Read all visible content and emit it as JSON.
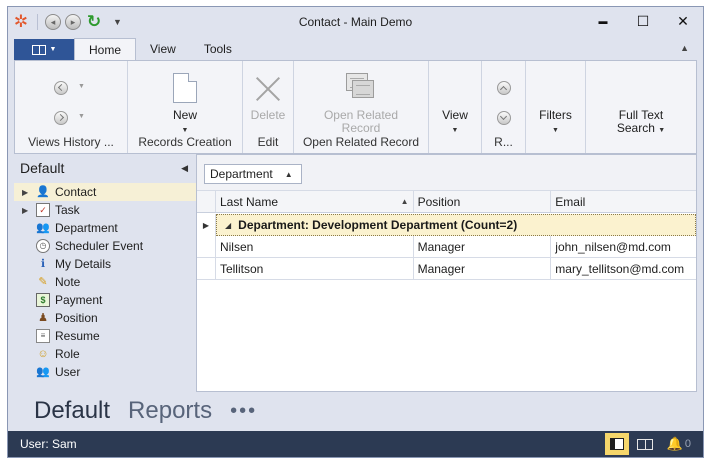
{
  "window": {
    "title": "Contact - Main Demo"
  },
  "quick_access": {
    "icons": [
      "app-gear-icon",
      "back-icon",
      "forward-icon",
      "refresh-icon",
      "customize-icon"
    ]
  },
  "window_controls": {
    "minimize": "▬",
    "maximize": "☐",
    "close": "✕"
  },
  "ribbon_tabs": [
    {
      "label": "Home",
      "active": true
    },
    {
      "label": "View",
      "active": false
    },
    {
      "label": "Tools",
      "active": false
    }
  ],
  "ribbon": {
    "groups": [
      {
        "caption": "Views History ..."
      },
      {
        "caption": "Records Creation",
        "button": "New"
      },
      {
        "caption": "Edit",
        "button": "Delete"
      },
      {
        "caption": "Open Related Record",
        "button_line1": "Open Related",
        "button_line2": "Record"
      },
      {
        "caption": "",
        "button": "View"
      },
      {
        "caption": "R..."
      },
      {
        "caption": "",
        "button": "Filters"
      },
      {
        "caption": "",
        "button_line1": "Full Text",
        "button_line2": "Search"
      }
    ]
  },
  "sidebar": {
    "title": "Default",
    "items": [
      {
        "label": "Contact",
        "icon": "contact-icon",
        "expandable": true,
        "selected": true
      },
      {
        "label": "Task",
        "icon": "task-icon",
        "expandable": true,
        "selected": false
      },
      {
        "label": "Department",
        "icon": "department-icon",
        "expandable": false,
        "selected": false
      },
      {
        "label": "Scheduler Event",
        "icon": "scheduler-icon",
        "expandable": false,
        "selected": false
      },
      {
        "label": "My Details",
        "icon": "my-details-icon",
        "expandable": false,
        "selected": false
      },
      {
        "label": "Note",
        "icon": "note-icon",
        "expandable": false,
        "selected": false
      },
      {
        "label": "Payment",
        "icon": "payment-icon",
        "expandable": false,
        "selected": false
      },
      {
        "label": "Position",
        "icon": "position-icon",
        "expandable": false,
        "selected": false
      },
      {
        "label": "Resume",
        "icon": "resume-icon",
        "expandable": false,
        "selected": false
      },
      {
        "label": "Role",
        "icon": "role-icon",
        "expandable": false,
        "selected": false
      },
      {
        "label": "User",
        "icon": "user-icon",
        "expandable": false,
        "selected": false
      }
    ]
  },
  "grid": {
    "group_by_chip": "Department",
    "columns": [
      "Last Name",
      "Position",
      "Email"
    ],
    "group_row": "Department: Development Department (Count=2)",
    "rows": [
      {
        "last_name": "Nilsen",
        "position": "Manager",
        "email": "john_nilsen@md.com"
      },
      {
        "last_name": "Tellitson",
        "position": "Manager",
        "email": "mary_tellitson@md.com"
      }
    ]
  },
  "bottom_nav": {
    "items": [
      "Default",
      "Reports"
    ],
    "active": "Default",
    "more": "•••"
  },
  "status": {
    "user": "User: Sam",
    "notifications": "0"
  },
  "colors": {
    "accent": "#2f5597",
    "status_bar": "#2c3a53",
    "selected_item": "#f6f0d6",
    "group_row": "#fbf2cf",
    "toggle_on": "#f5d66b"
  }
}
